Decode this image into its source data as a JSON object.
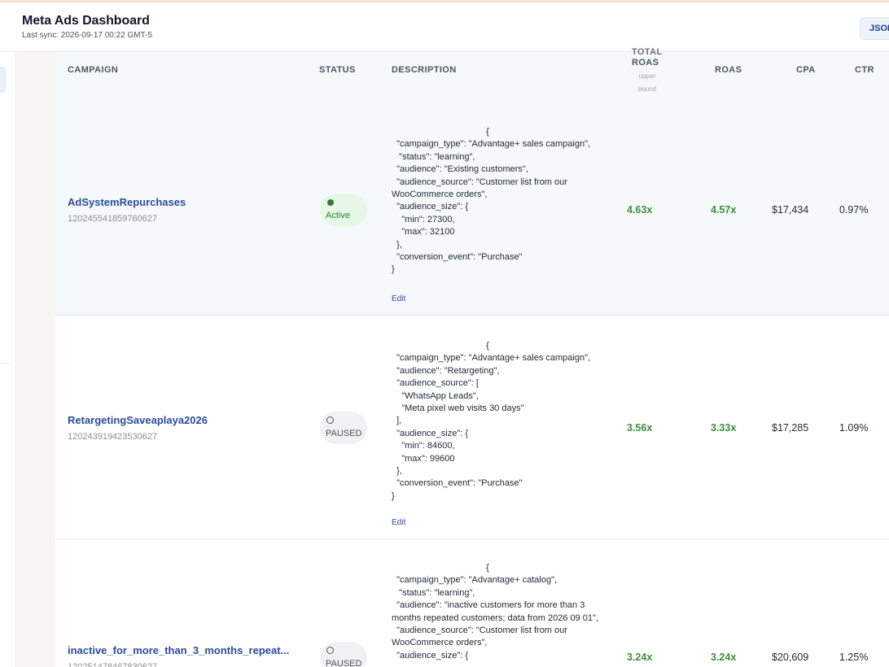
{
  "header": {
    "title": "Meta Ads Dashboard",
    "last_sync": "Last sync: 2026-09-17 00:22 GMT-5",
    "json_button": "JSON"
  },
  "table": {
    "columns": {
      "campaign": "CAMPAIGN",
      "status": "STATUS",
      "description": "DESCRIPTION",
      "total_roas_top": "TOTAL",
      "total_roas": "ROAS",
      "total_roas_sub1": "upper",
      "total_roas_sub2": "bound",
      "roas": "ROAS",
      "cpa": "CPA",
      "ctr": "CTR"
    },
    "rows": [
      {
        "name": "AdSystemRepurchases",
        "id": "120245541859760627",
        "status": "Active",
        "description": "                                      {\n  \"campaign_type\": \"Advantage+ sales campaign\",\n   \"status\": \"learning\",\n  \"audience\": \"Existing customers\",\n  \"audience_source\": \"Customer list from our WooCommerce orders\",\n  \"audience_size\": {\n    \"min\": 27300,\n    \"max\": 32100\n  },\n  \"conversion_event\": \"Purchase\"\n}",
        "edit": "Edit",
        "total_roas": "4.63x",
        "roas": "4.57x",
        "cpa": "$17,434",
        "ctr": "0.97%"
      },
      {
        "name": "RetargetingSaveaplaya2026",
        "id": "120243919423530627",
        "status": "PAUSED",
        "description": "                                      {\n  \"campaign_type\": \"Advantage+ sales campaign\",\n  \"audience\": \"Retargeting\",\n  \"audience_source\": [\n    \"WhatsApp Leads\",\n    \"Meta pixel web visits 30 days\"\n  ],\n  \"audience_size\": {\n    \"min\": 84600,\n    \"max\": 99600\n  },\n  \"conversion_event\": \"Purchase\"\n}",
        "edit": "Edit",
        "total_roas": "3.56x",
        "roas": "3.33x",
        "cpa": "$17,285",
        "ctr": "1.09%"
      },
      {
        "name": "inactive_for_more_than_3_months_repeat...",
        "id": "120251478467830627",
        "status": "PAUSED",
        "description": "                                      {\n  \"campaign_type\": \"Advantage+ catalog\",\n   \"status\": \"learning\",\n  \"audience\": \"inactive customers for more than 3 months repeated customers; data from 2026 09 01\",\n  \"audience_source\": \"Customer list from our WooCommerce orders\",\n  \"audience_size\": {",
        "total_roas": "3.24x",
        "roas": "3.24x",
        "cpa": "$20,609",
        "ctr": "1.25%"
      }
    ]
  }
}
